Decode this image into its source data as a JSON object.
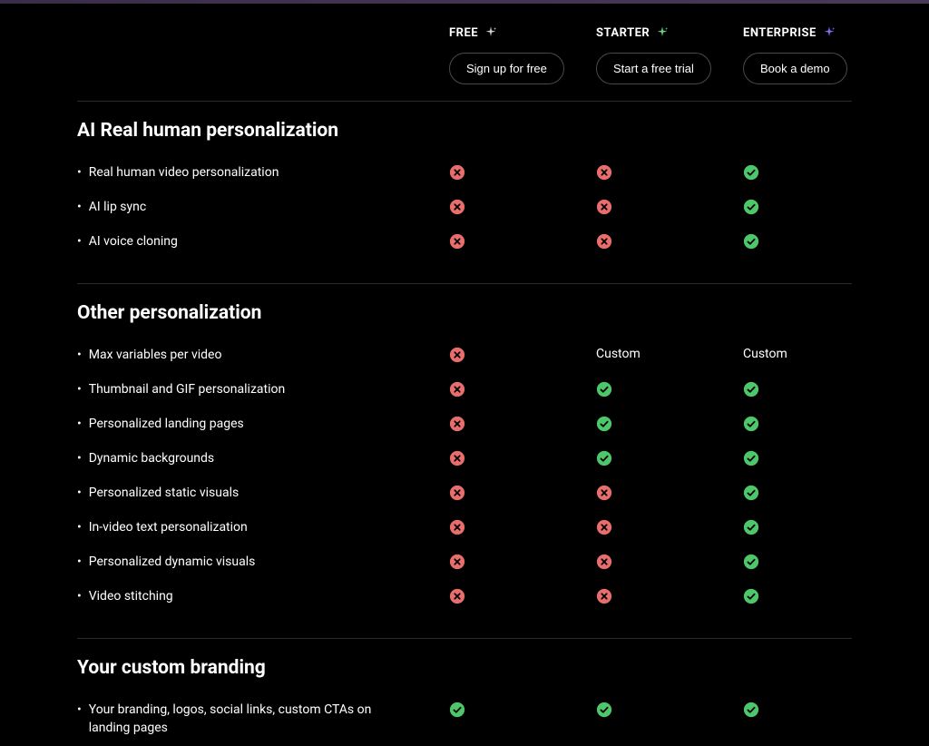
{
  "plans": [
    {
      "name": "FREE",
      "cta": "Sign up for free",
      "sparkle_color": "#d0d0d0"
    },
    {
      "name": "STARTER",
      "cta": "Start a free trial",
      "sparkle_color": "#6dd47e"
    },
    {
      "name": "ENTERPRISE",
      "cta": "Book a demo",
      "sparkle_color": "#8a6cff"
    }
  ],
  "sections": [
    {
      "title": "AI Real human personalization",
      "rows": [
        {
          "label": "Real human video personalization",
          "cells": [
            "cross",
            "cross",
            "check"
          ]
        },
        {
          "label": "AI lip sync",
          "cells": [
            "cross",
            "cross",
            "check"
          ]
        },
        {
          "label": "AI voice cloning",
          "cells": [
            "cross",
            "cross",
            "check"
          ]
        }
      ]
    },
    {
      "title": "Other personalization",
      "rows": [
        {
          "label": "Max variables per video",
          "cells": [
            "cross",
            "Custom",
            "Custom"
          ]
        },
        {
          "label": "Thumbnail and GIF personalization",
          "cells": [
            "cross",
            "check",
            "check"
          ]
        },
        {
          "label": "Personalized landing pages",
          "cells": [
            "cross",
            "check",
            "check"
          ]
        },
        {
          "label": "Dynamic backgrounds",
          "cells": [
            "cross",
            "check",
            "check"
          ]
        },
        {
          "label": "Personalized static visuals",
          "cells": [
            "cross",
            "cross",
            "check"
          ]
        },
        {
          "label": "In-video text personalization",
          "cells": [
            "cross",
            "cross",
            "check"
          ]
        },
        {
          "label": "Personalized dynamic visuals",
          "cells": [
            "cross",
            "cross",
            "check"
          ]
        },
        {
          "label": "Video stitching",
          "cells": [
            "cross",
            "cross",
            "check"
          ]
        }
      ]
    },
    {
      "title": "Your custom branding",
      "rows": [
        {
          "label": "Your branding, logos, social links, custom CTAs on landing pages",
          "cells": [
            "check",
            "check",
            "check"
          ]
        }
      ]
    }
  ]
}
